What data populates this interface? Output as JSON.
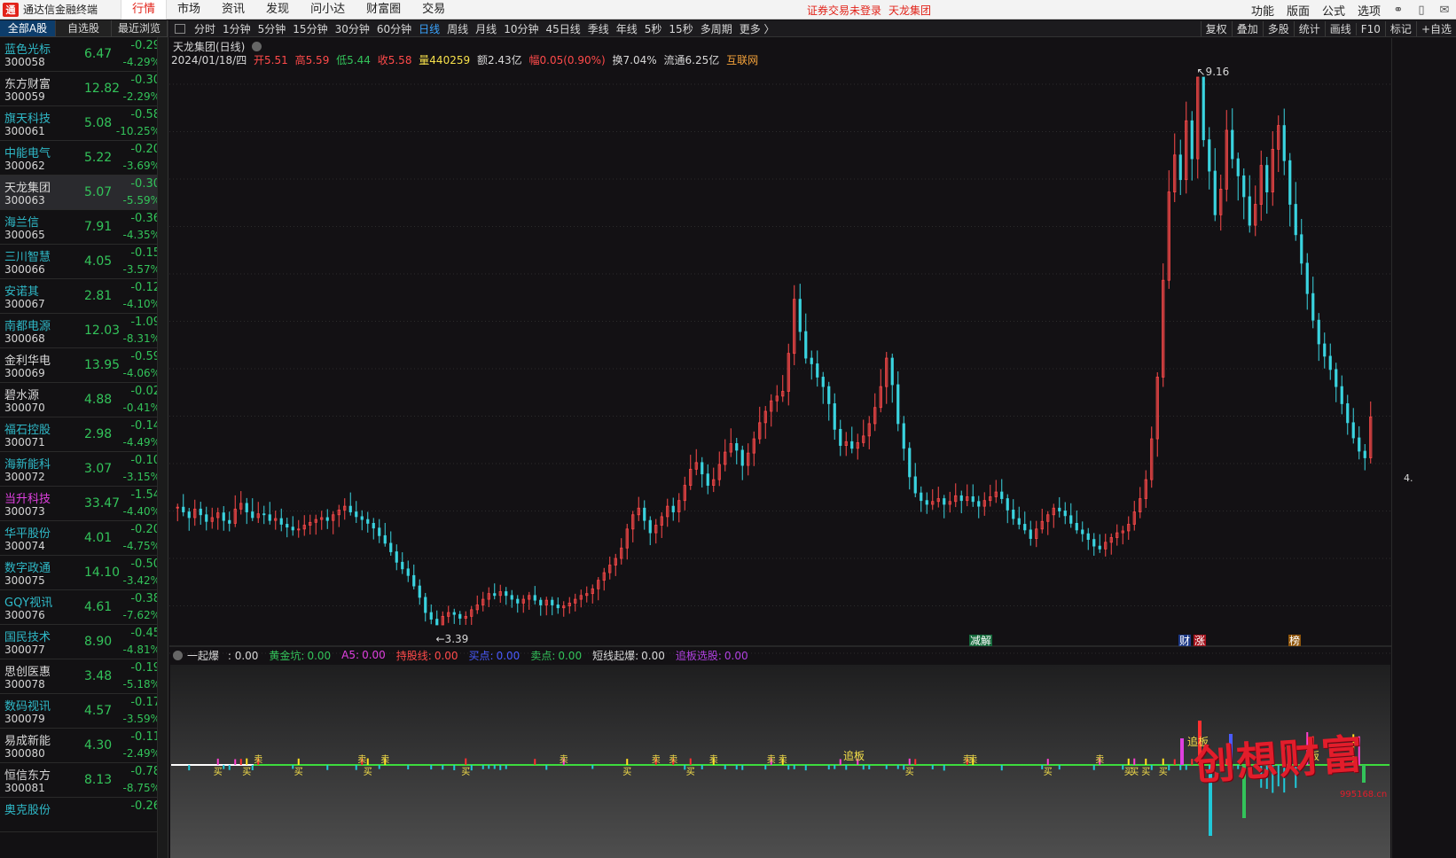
{
  "app": {
    "title": "通达信金融终端",
    "logo_char": "通"
  },
  "top_menu": [
    "行情",
    "市场",
    "资讯",
    "发现",
    "问小达",
    "财富圈",
    "交易"
  ],
  "login_status": "证券交易未登录",
  "login_company": "天龙集团",
  "top_right": [
    "功能",
    "版面",
    "公式",
    "选项"
  ],
  "list_tabs": [
    "全部A股",
    "自选股",
    "最近浏览"
  ],
  "stocks": [
    {
      "name": "蓝色光标",
      "code": "300058",
      "price": "6.47",
      "change": "-0.29",
      "pct": "-4.29%",
      "name_color": "#2fb9c8"
    },
    {
      "name": "东方财富",
      "code": "300059",
      "price": "12.82",
      "change": "-0.30",
      "pct": "-2.29%",
      "name_color": "#d8d8d8"
    },
    {
      "name": "旗天科技",
      "code": "300061",
      "price": "5.08",
      "change": "-0.58",
      "pct": "-10.25%",
      "name_color": "#2fb9c8"
    },
    {
      "name": "中能电气",
      "code": "300062",
      "price": "5.22",
      "change": "-0.20",
      "pct": "-3.69%",
      "name_color": "#2fb9c8"
    },
    {
      "name": "天龙集团",
      "code": "300063",
      "price": "5.07",
      "change": "-0.30",
      "pct": "-5.59%",
      "name_color": "#d8d8d8"
    },
    {
      "name": "海兰信",
      "code": "300065",
      "price": "7.91",
      "change": "-0.36",
      "pct": "-4.35%",
      "name_color": "#2fb9c8"
    },
    {
      "name": "三川智慧",
      "code": "300066",
      "price": "4.05",
      "change": "-0.15",
      "pct": "-3.57%",
      "name_color": "#2fb9c8"
    },
    {
      "name": "安诺其",
      "code": "300067",
      "price": "2.81",
      "change": "-0.12",
      "pct": "-4.10%",
      "name_color": "#2fb9c8"
    },
    {
      "name": "南都电源",
      "code": "300068",
      "price": "12.03",
      "change": "-1.09",
      "pct": "-8.31%",
      "name_color": "#2fb9c8"
    },
    {
      "name": "金利华电",
      "code": "300069",
      "price": "13.95",
      "change": "-0.59",
      "pct": "-4.06%",
      "name_color": "#d8d8d8"
    },
    {
      "name": "碧水源",
      "code": "300070",
      "price": "4.88",
      "change": "-0.02",
      "pct": "-0.41%",
      "name_color": "#d8d8d8"
    },
    {
      "name": "福石控股",
      "code": "300071",
      "price": "2.98",
      "change": "-0.14",
      "pct": "-4.49%",
      "name_color": "#2fb9c8"
    },
    {
      "name": "海新能科",
      "code": "300072",
      "price": "3.07",
      "change": "-0.10",
      "pct": "-3.15%",
      "name_color": "#2fb9c8"
    },
    {
      "name": "当升科技",
      "code": "300073",
      "price": "33.47",
      "change": "-1.54",
      "pct": "-4.40%",
      "name_color": "#e040e0"
    },
    {
      "name": "华平股份",
      "code": "300074",
      "price": "4.01",
      "change": "-0.20",
      "pct": "-4.75%",
      "name_color": "#2fb9c8"
    },
    {
      "name": "数字政通",
      "code": "300075",
      "price": "14.10",
      "change": "-0.50",
      "pct": "-3.42%",
      "name_color": "#2fb9c8"
    },
    {
      "name": "GQY视讯",
      "code": "300076",
      "price": "4.61",
      "change": "-0.38",
      "pct": "-7.62%",
      "name_color": "#2fb9c8"
    },
    {
      "name": "国民技术",
      "code": "300077",
      "price": "8.90",
      "change": "-0.45",
      "pct": "-4.81%",
      "name_color": "#2fb9c8"
    },
    {
      "name": "思创医惠",
      "code": "300078",
      "price": "3.48",
      "change": "-0.19",
      "pct": "-5.18%",
      "name_color": "#d8d8d8"
    },
    {
      "name": "数码视讯",
      "code": "300079",
      "price": "4.57",
      "change": "-0.17",
      "pct": "-3.59%",
      "name_color": "#2fb9c8"
    },
    {
      "name": "易成新能",
      "code": "300080",
      "price": "4.30",
      "change": "-0.11",
      "pct": "-2.49%",
      "name_color": "#d8d8d8"
    },
    {
      "name": "恒信东方",
      "code": "300081",
      "price": "8.13",
      "change": "-0.78",
      "pct": "-8.75%",
      "name_color": "#d8d8d8"
    },
    {
      "name": "奥克股份",
      "code": "",
      "price": "",
      "change": "-0.26",
      "pct": "",
      "name_color": "#2fb9c8"
    }
  ],
  "periods": [
    "分时",
    "1分钟",
    "5分钟",
    "15分钟",
    "30分钟",
    "60分钟",
    "日线",
    "周线",
    "月线",
    "10分钟",
    "45日线",
    "季线",
    "年线",
    "5秒",
    "15秒",
    "多周期",
    "更多 〉"
  ],
  "active_period": "日线",
  "right_tools": [
    "复权",
    "叠加",
    "多股",
    "统计",
    "画线",
    "F10",
    "标记",
    "+自选"
  ],
  "chart": {
    "title": "天龙集团(日线)",
    "date": "2024/01/18/四",
    "open": "开5.51",
    "high": "高5.59",
    "low": "低5.44",
    "close": "收5.58",
    "volume": "量440259",
    "amount": "额2.43亿",
    "range": "幅0.05(0.90%)",
    "turnover": "换7.04%",
    "float_cap": "流通6.25亿",
    "sector": "互联网",
    "high_label": "9.16",
    "low_label": "3.39",
    "scale_mark": "4.",
    "event_tags": [
      "减解",
      "财",
      "涨",
      "榜"
    ]
  },
  "indicator": {
    "name": "一起爆",
    "value": "0.00",
    "items": [
      {
        "label": "黄金坑:",
        "value": "0.00",
        "color": "#33c35a"
      },
      {
        "label": "A5:",
        "value": "0.00",
        "color": "#e040e0"
      },
      {
        "label": "持股线:",
        "value": "0.00",
        "color": "#ff4a4a"
      },
      {
        "label": "买点:",
        "value": "0.00",
        "color": "#4a5bff"
      },
      {
        "label": "卖点:",
        "value": "0.00",
        "color": "#33c35a"
      },
      {
        "label": "短线起爆:",
        "value": "0.00",
        "color": "#d8d8d8"
      },
      {
        "label": "追板选股:",
        "value": "0.00",
        "color": "#b040e0"
      }
    ],
    "tags": [
      "追板",
      "追板",
      "板",
      "买",
      "卖"
    ]
  },
  "watermark": {
    "text": "创想财富",
    "url": "995168.cn"
  },
  "colors": {
    "up": "#ff4a4a",
    "down": "#3ad4e0",
    "accent": "#e2231a"
  },
  "chart_data": {
    "type": "candlestick",
    "title": "天龙集团(日线)",
    "close_series": [
      4.63,
      4.58,
      4.52,
      4.61,
      4.55,
      4.48,
      4.52,
      4.57,
      4.49,
      4.46,
      4.61,
      4.67,
      4.58,
      4.52,
      4.56,
      4.55,
      4.49,
      4.51,
      4.45,
      4.42,
      4.39,
      4.4,
      4.44,
      4.47,
      4.5,
      4.52,
      4.49,
      4.55,
      4.6,
      4.64,
      4.58,
      4.53,
      4.5,
      4.46,
      4.41,
      4.33,
      4.25,
      4.16,
      4.05,
      3.98,
      3.91,
      3.8,
      3.68,
      3.52,
      3.45,
      3.39,
      3.48,
      3.52,
      3.5,
      3.46,
      3.48,
      3.55,
      3.6,
      3.66,
      3.72,
      3.7,
      3.74,
      3.7,
      3.66,
      3.62,
      3.66,
      3.7,
      3.65,
      3.6,
      3.65,
      3.6,
      3.57,
      3.59,
      3.62,
      3.66,
      3.7,
      3.72,
      3.77,
      3.86,
      3.94,
      4.02,
      4.09,
      4.2,
      4.4,
      4.55,
      4.62,
      4.49,
      4.36,
      4.44,
      4.53,
      4.64,
      4.58,
      4.7,
      4.86,
      5.03,
      5.1,
      4.98,
      4.86,
      4.92,
      5.08,
      5.21,
      5.3,
      5.23,
      5.07,
      5.2,
      5.35,
      5.52,
      5.64,
      5.75,
      5.8,
      5.85,
      6.25,
      6.82,
      6.48,
      6.2,
      6.14,
      6.0,
      5.9,
      5.72,
      5.45,
      5.28,
      5.32,
      5.25,
      5.31,
      5.38,
      5.51,
      5.68,
      5.9,
      6.2,
      5.92,
      5.51,
      5.25,
      4.95,
      4.78,
      4.7,
      4.66,
      4.69,
      4.72,
      4.66,
      4.69,
      4.75,
      4.7,
      4.74,
      4.69,
      4.64,
      4.7,
      4.74,
      4.79,
      4.72,
      4.6,
      4.51,
      4.45,
      4.39,
      4.3,
      4.4,
      4.48,
      4.55,
      4.62,
      4.59,
      4.54,
      4.46,
      4.39,
      4.35,
      4.29,
      4.22,
      4.19,
      4.26,
      4.31,
      4.36,
      4.38,
      4.45,
      4.58,
      4.72,
      4.92,
      5.35,
      6.0,
      7.02,
      7.95,
      8.34,
      8.08,
      8.7,
      8.3,
      9.16,
      8.5,
      8.17,
      7.71,
      7.98,
      8.6,
      8.3,
      8.12,
      7.9,
      7.6,
      7.82,
      8.23,
      7.95,
      8.4,
      8.65,
      8.28,
      7.82,
      7.5,
      7.2,
      6.88,
      6.6,
      6.35,
      6.22,
      6.08,
      5.9,
      5.72,
      5.52,
      5.36,
      5.22,
      5.15,
      5.58
    ],
    "ylim": [
      3.39,
      9.16
    ],
    "high_label": 9.16,
    "low_label": 3.39
  }
}
